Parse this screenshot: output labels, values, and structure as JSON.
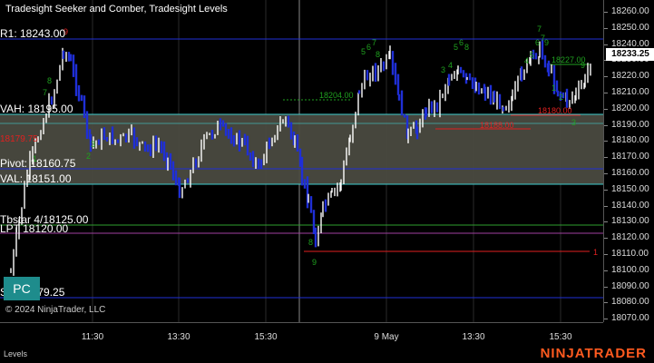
{
  "chart": {
    "title": "Tradesight Seeker and Comber, Tradesight Levels",
    "copyright": "© 2024 NinjaTrader, LLC"
  },
  "levels": {
    "r1": "R1: 18243.00",
    "vah": "VAH: 18195.00",
    "pivot": "Pivot: 18160.75",
    "val": "VAL: 18151.00",
    "left_red": "18179.75",
    "overlap_text": "Tbstar 4/18125.00",
    "lpt": "LPT 18120.00",
    "s1": "S1: 18079.25"
  },
  "pc_button": "PC",
  "price_axis": {
    "ticks": [
      "18260.00",
      "18250.00",
      "18240.00",
      "18230.00",
      "18220.00",
      "18210.00",
      "18200.00",
      "18190.00",
      "18180.00",
      "18170.00",
      "18160.00",
      "18150.00",
      "18140.00",
      "18130.00",
      "18120.00",
      "18110.00",
      "18100.00",
      "18090.00",
      "18080.00",
      "18070.00"
    ],
    "last_price": "18233.25"
  },
  "time_axis": {
    "ticks": [
      "11:30",
      "13:30",
      "15:30",
      "9 May",
      "13:30",
      "15:30"
    ]
  },
  "annotations": {
    "green_level_1": "18204.00",
    "green_level_2": "18227.00",
    "red_level_1": "18188.00",
    "red_level_2": "18180.00",
    "right_marker": "1"
  },
  "status_bar": {
    "text": "Levels",
    "brand": "NINJATRADER"
  },
  "colors": {
    "up_bar": "#ffffff",
    "down_bar": "#1f2fd6",
    "r1_line": "#1f2fd6",
    "value_area": "#4a4a40",
    "value_area_border": "#3fcfcf",
    "pivot_line": "#1f2fd6",
    "red": "#e02020",
    "green": "#1fa01f"
  }
}
